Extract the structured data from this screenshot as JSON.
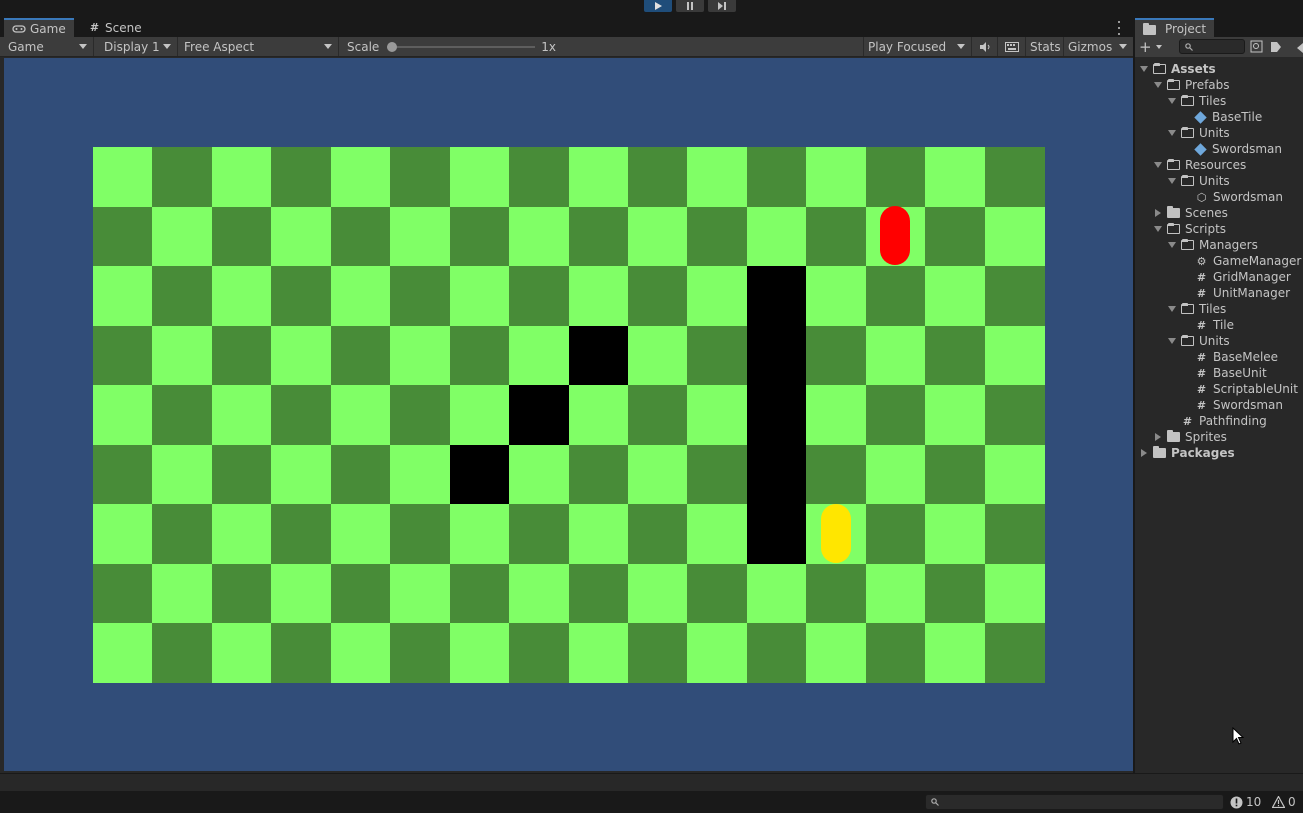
{
  "playbar": {
    "buttons": [
      "play-icon",
      "pause-icon",
      "step-icon"
    ]
  },
  "game_tabs": [
    {
      "label": "Game",
      "icon": "gamepad-icon"
    },
    {
      "label": "Scene",
      "icon": "hash-icon"
    }
  ],
  "game_toolbar": {
    "view_mode": "Game",
    "display": "Display 1",
    "aspect": "Free Aspect",
    "scale_label": "Scale",
    "scale_value": "1x",
    "play_mode": "Play Focused",
    "stats": "Stats",
    "gizmos": "Gizmos"
  },
  "game_grid": {
    "columns": 16,
    "rows": 9,
    "light_color": "#80ff66",
    "dark_color": "#488c38",
    "blocked_color": "#000000",
    "blocked_cells": [
      [
        6,
        3
      ],
      [
        7,
        4
      ],
      [
        8,
        5
      ],
      [
        11,
        2
      ],
      [
        11,
        3
      ],
      [
        11,
        4
      ],
      [
        11,
        5
      ],
      [
        11,
        6
      ]
    ],
    "units": [
      {
        "name": "red-unit",
        "color": "#ff0000",
        "col": 13,
        "row": 7
      },
      {
        "name": "yellow-unit",
        "color": "#ffe600",
        "col": 12,
        "row": 2
      }
    ]
  },
  "project": {
    "tab": "Project",
    "tree": [
      {
        "label": "Assets",
        "depth": 0,
        "toggle": "open",
        "icon": "folder-open-icon",
        "bold": true
      },
      {
        "label": "Prefabs",
        "depth": 1,
        "toggle": "open",
        "icon": "folder-open-icon"
      },
      {
        "label": "Tiles",
        "depth": 2,
        "toggle": "open",
        "icon": "folder-open-icon"
      },
      {
        "label": "BaseTile",
        "depth": 3,
        "toggle": "none",
        "icon": "prefab-icon"
      },
      {
        "label": "Units",
        "depth": 2,
        "toggle": "open",
        "icon": "folder-open-icon"
      },
      {
        "label": "Swordsman",
        "depth": 3,
        "toggle": "none",
        "icon": "prefab-icon"
      },
      {
        "label": "Resources",
        "depth": 1,
        "toggle": "open",
        "icon": "folder-open-icon"
      },
      {
        "label": "Units",
        "depth": 2,
        "toggle": "open",
        "icon": "folder-open-icon"
      },
      {
        "label": "Swordsman",
        "depth": 3,
        "toggle": "none",
        "icon": "scriptable-object-icon"
      },
      {
        "label": "Scenes",
        "depth": 1,
        "toggle": "closed",
        "icon": "folder-icon"
      },
      {
        "label": "Scripts",
        "depth": 1,
        "toggle": "open",
        "icon": "folder-open-icon"
      },
      {
        "label": "Managers",
        "depth": 2,
        "toggle": "open",
        "icon": "folder-open-icon"
      },
      {
        "label": "GameManager",
        "depth": 3,
        "toggle": "none",
        "icon": "gear-icon"
      },
      {
        "label": "GridManager",
        "depth": 3,
        "toggle": "none",
        "icon": "script-icon"
      },
      {
        "label": "UnitManager",
        "depth": 3,
        "toggle": "none",
        "icon": "script-icon"
      },
      {
        "label": "Tiles",
        "depth": 2,
        "toggle": "open",
        "icon": "folder-open-icon"
      },
      {
        "label": "Tile",
        "depth": 3,
        "toggle": "none",
        "icon": "script-icon"
      },
      {
        "label": "Units",
        "depth": 2,
        "toggle": "open",
        "icon": "folder-open-icon"
      },
      {
        "label": "BaseMelee",
        "depth": 3,
        "toggle": "none",
        "icon": "script-icon"
      },
      {
        "label": "BaseUnit",
        "depth": 3,
        "toggle": "none",
        "icon": "script-icon"
      },
      {
        "label": "ScriptableUnit",
        "depth": 3,
        "toggle": "none",
        "icon": "script-icon"
      },
      {
        "label": "Swordsman",
        "depth": 3,
        "toggle": "none",
        "icon": "script-icon"
      },
      {
        "label": "Pathfinding",
        "depth": 2,
        "toggle": "none",
        "icon": "script-icon"
      },
      {
        "label": "Sprites",
        "depth": 1,
        "toggle": "closed",
        "icon": "folder-icon"
      },
      {
        "label": "Packages",
        "depth": 0,
        "toggle": "closed",
        "icon": "folder-icon",
        "bold": true
      }
    ]
  },
  "status": {
    "errors": "10",
    "warnings": "0"
  }
}
